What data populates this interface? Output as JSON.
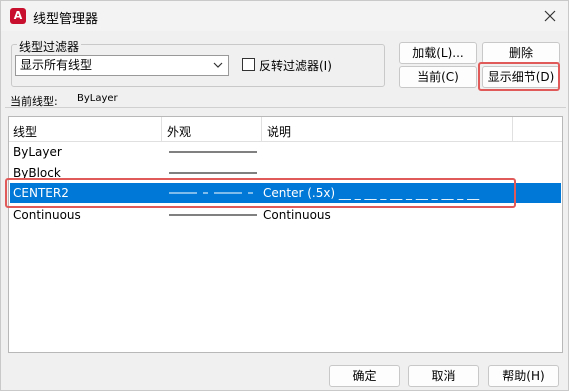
{
  "window": {
    "title": "线型管理器",
    "app_icon_letter": "A"
  },
  "filter": {
    "group_label": "线型过滤器",
    "selected": "显示所有线型",
    "invert_label": "反转过滤器(I)",
    "invert_checked": false
  },
  "buttons": {
    "load": "加载(L)...",
    "delete": "删除",
    "current": "当前(C)",
    "show_details": "显示细节(D)",
    "ok": "确定",
    "cancel": "取消",
    "help": "帮助(H)"
  },
  "current_linetype": {
    "label": "当前线型:",
    "value": "ByLayer"
  },
  "table": {
    "headers": [
      "线型",
      "外观",
      "说明"
    ],
    "rows": [
      {
        "name": "ByLayer",
        "appearance": "continuous",
        "description": ""
      },
      {
        "name": "ByBlock",
        "appearance": "continuous",
        "description": ""
      },
      {
        "name": "CENTER2",
        "appearance": "center",
        "description": "Center (.5x) __ _ __ _ __ _ __ _ __ _ __",
        "selected": true
      },
      {
        "name": "Continuous",
        "appearance": "continuous",
        "description": "Continuous"
      }
    ]
  },
  "colors": {
    "selection": "#0078d7",
    "highlight": "#e05a5a",
    "app_icon": "#c8102e"
  }
}
